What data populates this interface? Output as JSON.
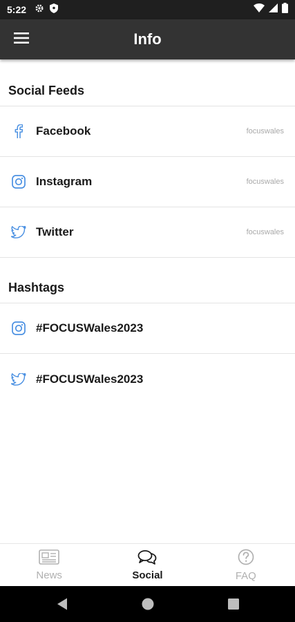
{
  "status_bar": {
    "time": "5:22",
    "icons": [
      "gear-icon",
      "shield-icon",
      "wifi-icon",
      "signal-icon",
      "battery-icon"
    ]
  },
  "app_bar": {
    "title": "Info",
    "menu_icon": "hamburger-icon"
  },
  "social_feeds": {
    "header": "Social Feeds",
    "items": [
      {
        "icon": "facebook-icon",
        "label": "Facebook",
        "handle": "focuswales"
      },
      {
        "icon": "instagram-icon",
        "label": "Instagram",
        "handle": "focuswales"
      },
      {
        "icon": "twitter-icon",
        "label": "Twitter",
        "handle": "focuswales"
      }
    ]
  },
  "hashtags": {
    "header": "Hashtags",
    "items": [
      {
        "icon": "instagram-icon",
        "label": "#FOCUSWales2023"
      },
      {
        "icon": "twitter-icon",
        "label": "#FOCUSWales2023"
      }
    ]
  },
  "bottom_nav": {
    "tabs": [
      {
        "icon": "newspaper-icon",
        "label": "News",
        "active": false
      },
      {
        "icon": "chat-bubbles-icon",
        "label": "Social",
        "active": true
      },
      {
        "icon": "question-circle-icon",
        "label": "FAQ",
        "active": false
      }
    ]
  },
  "colors": {
    "accent": "#4a90e2",
    "app_bar": "#333333",
    "status_bar": "#1f1f1f"
  }
}
